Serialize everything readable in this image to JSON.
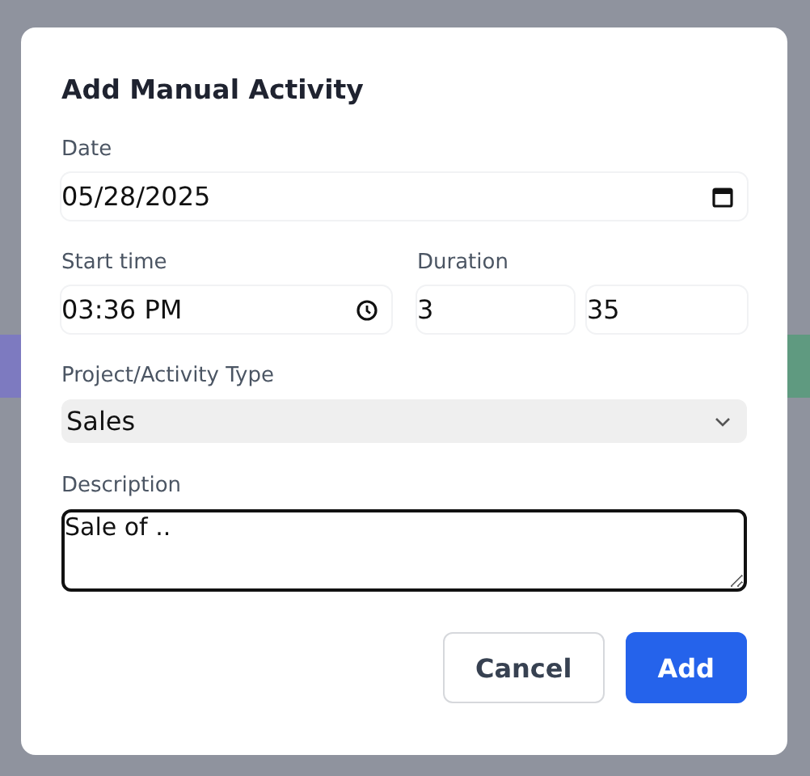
{
  "dialog": {
    "title": "Add Manual Activity",
    "fields": [
      {
        "kind": "date",
        "label": "Date",
        "value": "05/28/2025"
      },
      {
        "kind": "time",
        "label": "Start time",
        "value": "03:36 PM"
      },
      {
        "kind": "duration",
        "label": "Duration",
        "hours": "3",
        "minutes": "35"
      },
      {
        "kind": "select",
        "label": "Project/Activity Type",
        "value": "Sales"
      },
      {
        "kind": "textarea",
        "label": "Description",
        "value": "Sale of ..",
        "focused": true
      }
    ],
    "buttons": [
      {
        "label": "Cancel",
        "kind": "secondary"
      },
      {
        "label": "Add",
        "kind": "primary"
      }
    ]
  }
}
